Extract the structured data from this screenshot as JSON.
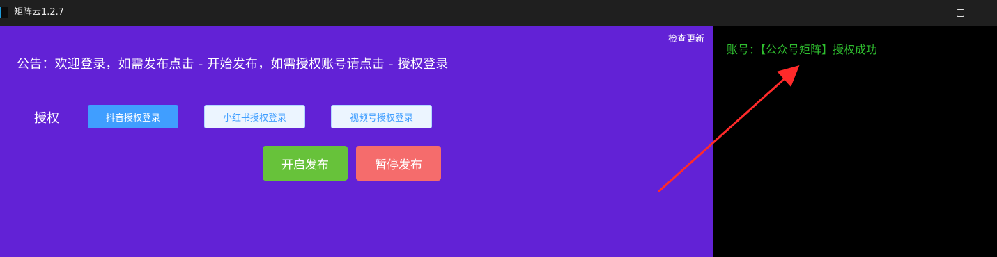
{
  "window": {
    "title": "矩阵云1.2.7",
    "controls": [
      "minimize",
      "maximize"
    ]
  },
  "panel": {
    "check_update": "检查更新",
    "notice": "公告：欢迎登录，如需发布点击 - 开始发布，如需授权账号请点击 - 授权登录",
    "auth_label": "授权",
    "auth_buttons": {
      "douyin": "抖音授权登录",
      "xiaohongshu": "小红书授权登录",
      "shipinhao": "视频号授权登录"
    },
    "actions": {
      "start": "开启发布",
      "pause": "暂停发布"
    }
  },
  "log": {
    "line1": "账号：【公众号矩阵】授权成功"
  },
  "colors": {
    "panel_bg": "#6222d6",
    "primary": "#409eff",
    "success": "#67c23a",
    "danger": "#f56c6c",
    "log_text": "#2fbf2f",
    "arrow": "#ff2a2a"
  }
}
